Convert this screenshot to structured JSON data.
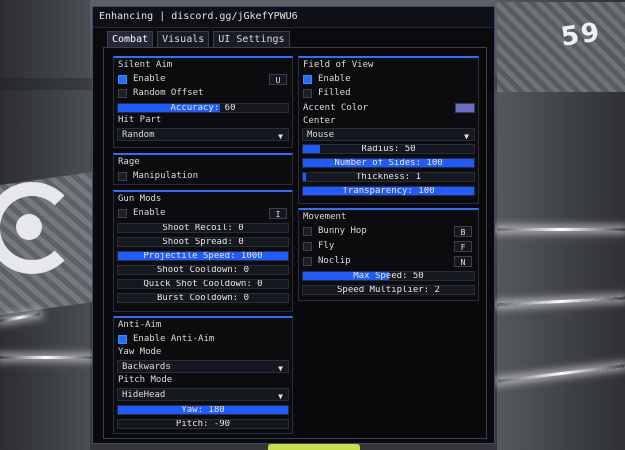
{
  "window": {
    "title": "Enhancing | discord.gg/jGkefYPWU6"
  },
  "scene": {
    "pad_text": "59",
    "accent_color": "#1f5cff"
  },
  "tabs": [
    {
      "label": "Combat",
      "active": true
    },
    {
      "label": "Visuals",
      "active": false
    },
    {
      "label": "UI Settings",
      "active": false
    }
  ],
  "silent_aim": {
    "title": "Silent Aim",
    "enable": {
      "label": "Enable",
      "checked": true,
      "key": "U"
    },
    "random_offset": {
      "label": "Random Offset",
      "checked": false
    },
    "accuracy": {
      "label": "Accuracy: 60",
      "value": 60,
      "max": 100
    },
    "hit_part_label": "Hit Part",
    "hit_part_value": "Random"
  },
  "rage": {
    "title": "Rage",
    "manipulation": {
      "label": "Manipulation",
      "checked": false
    }
  },
  "gun_mods": {
    "title": "Gun Mods",
    "enable": {
      "label": "Enable",
      "checked": false,
      "key": "I"
    },
    "shoot_recoil": {
      "label": "Shoot Recoil: 0",
      "value": 0,
      "max": 100
    },
    "shoot_spread": {
      "label": "Shoot Spread: 0",
      "value": 0,
      "max": 100
    },
    "projectile_speed": {
      "label": "Projectile Speed: 1000",
      "value": 1000,
      "max": 1000
    },
    "shoot_cooldown": {
      "label": "Shoot Cooldown: 0",
      "value": 0,
      "max": 100
    },
    "quick_shot_cooldown": {
      "label": "Quick Shot Cooldown: 0",
      "value": 0,
      "max": 100
    },
    "burst_cooldown": {
      "label": "Burst Cooldown: 0",
      "value": 0,
      "max": 100
    }
  },
  "anti_aim": {
    "title": "Anti-Aim",
    "enable": {
      "label": "Enable Anti-Aim",
      "checked": true
    },
    "yaw_mode_label": "Yaw Mode",
    "yaw_mode_value": "Backwards",
    "pitch_mode_label": "Pitch Mode",
    "pitch_mode_value": "HideHead",
    "yaw": {
      "label": "Yaw: 180",
      "value": 180,
      "max": 180
    },
    "pitch": {
      "label": "Pitch: -90",
      "value": 0,
      "max": 100
    }
  },
  "fov": {
    "title": "Field of View",
    "enable": {
      "label": "Enable",
      "checked": true
    },
    "filled": {
      "label": "Filled",
      "checked": false
    },
    "accent_color_label": "Accent Color",
    "accent_color": "#6c6cc8",
    "center_label": "Center",
    "center_value": "Mouse",
    "radius": {
      "label": "Radius: 50",
      "value": 0.1
    },
    "sides": {
      "label": "Number of Sides: 100",
      "value": 1
    },
    "thickness": {
      "label": "Thickness: 1",
      "value": 0.02
    },
    "transparency": {
      "label": "Transparency: 100",
      "value": 1
    }
  },
  "movement": {
    "title": "Movement",
    "bunny_hop": {
      "label": "Bunny Hop",
      "checked": false,
      "key": "B"
    },
    "fly": {
      "label": "Fly",
      "checked": false,
      "key": "F"
    },
    "noclip": {
      "label": "Noclip",
      "checked": false,
      "key": "N"
    },
    "max_speed": {
      "label": "Max Speed: 50",
      "value": 0.5
    },
    "speed_multiplier": {
      "label": "Speed Multiplier: 2",
      "value": 0
    }
  }
}
